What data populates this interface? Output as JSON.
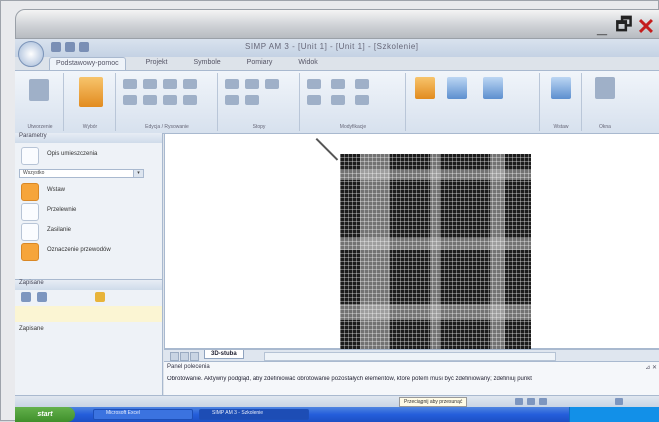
{
  "window": {
    "minimize_glyph": "_",
    "restore_glyph": "🗗",
    "close_glyph": "✕",
    "doc_title": "SIMP AM 3 - [Unit 1] - [Unit 1] - [Szkolenie]"
  },
  "ribbon": {
    "tabs": [
      "Podstawowy-pomoc",
      "Projekt",
      "Symbole",
      "Pomiary",
      "Widok"
    ],
    "groups": [
      "Utworzenie",
      "Wybór",
      "Edycja / Rysowanie",
      "Stopy",
      "Modyfikacje",
      "",
      "Wstaw",
      "Okna"
    ]
  },
  "left_panel": {
    "header": "Parametry",
    "items": [
      {
        "label": "Opis umieszczenia",
        "icon": "layer-icon"
      },
      {
        "label": "Wstaw",
        "icon": "insert-icon"
      },
      {
        "label": "Przelewnie",
        "icon": "flow-icon"
      },
      {
        "label": "Zasilanie",
        "icon": "power-icon"
      },
      {
        "label": "Oznaczenie przewodów",
        "icon": "wire-icon"
      }
    ],
    "select_value": "Wszystko",
    "select_arrow": "▾",
    "second_header": "Zapisane",
    "second_text": "Zapisane"
  },
  "sheet": {
    "tab_label": "3D-stuba",
    "nav_prev": "◄",
    "nav_next": "►"
  },
  "command": {
    "label": "Panel polecenia",
    "controls": "⊿ ✕",
    "text": "Obrotowanie. Aktywny podgląd, aby zdefiniować obrotowanie pozostałych elementów, które potem musi być zdefiniowany; zdefiniuj punkt"
  },
  "status": {
    "tooltip": "Przeciągnij aby przesunąć"
  },
  "taskbar": {
    "start_label": "start",
    "items": [
      "Microsoft Excel",
      "SIMP AM 3 - Szkolenie"
    ]
  }
}
